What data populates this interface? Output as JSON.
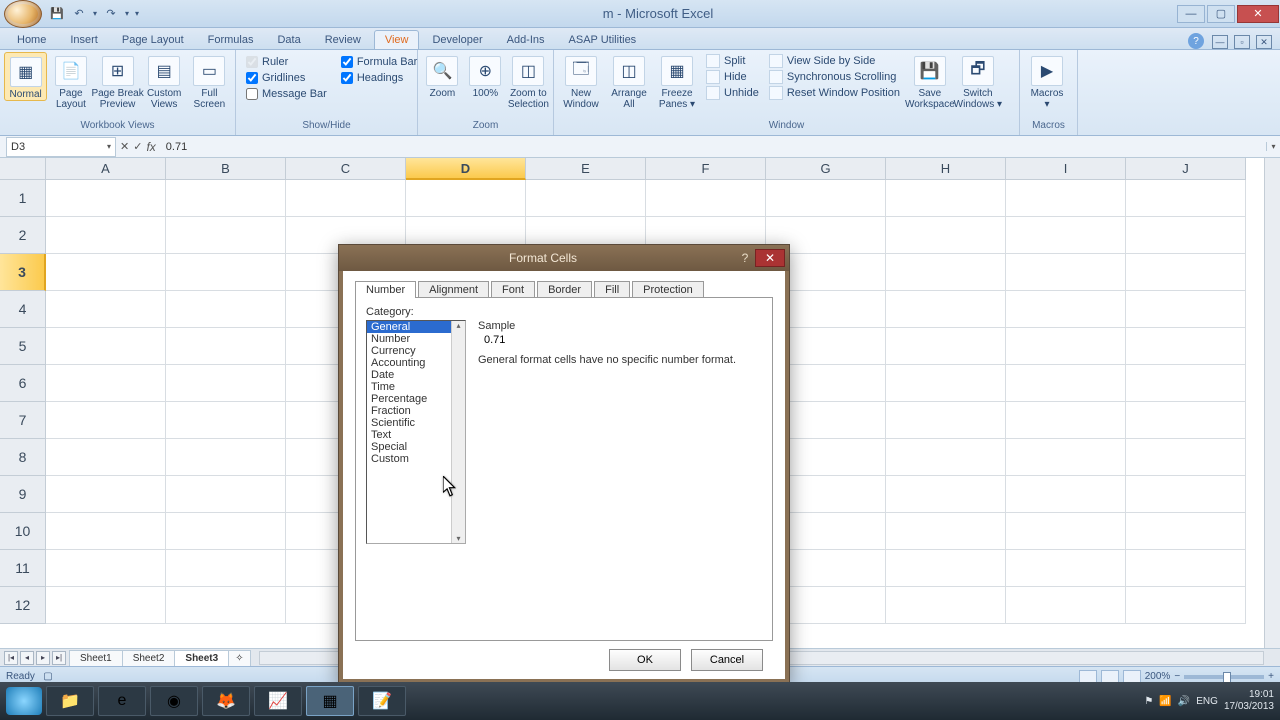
{
  "app": {
    "title": "m - Microsoft Excel"
  },
  "qat": {
    "save": "💾",
    "undo": "↶",
    "redo": "↷"
  },
  "tabs": [
    "Home",
    "Insert",
    "Page Layout",
    "Formulas",
    "Data",
    "Review",
    "View",
    "Developer",
    "Add-Ins",
    "ASAP Utilities"
  ],
  "active_tab": "View",
  "ribbon": {
    "workbook_views": {
      "label": "Workbook Views",
      "normal": "Normal",
      "page_layout": "Page\nLayout",
      "page_break": "Page Break\nPreview",
      "custom": "Custom\nViews",
      "full": "Full\nScreen"
    },
    "show_hide": {
      "label": "Show/Hide",
      "ruler": "Ruler",
      "gridlines": "Gridlines",
      "message_bar": "Message Bar",
      "formula_bar": "Formula Bar",
      "headings": "Headings"
    },
    "zoom_g": {
      "label": "Zoom",
      "zoom": "Zoom",
      "p100": "100%",
      "zoom_sel": "Zoom to\nSelection"
    },
    "window": {
      "label": "Window",
      "new": "New\nWindow",
      "arrange": "Arrange\nAll",
      "freeze": "Freeze\nPanes ▾",
      "split": "Split",
      "hide": "Hide",
      "unhide": "Unhide",
      "side": "View Side by Side",
      "sync": "Synchronous Scrolling",
      "reset": "Reset Window Position",
      "save_ws": "Save\nWorkspace",
      "switch": "Switch\nWindows ▾"
    },
    "macros": {
      "label": "Macros",
      "btn": "Macros\n▾"
    }
  },
  "namebox": "D3",
  "formula": "0.71",
  "columns": [
    "A",
    "B",
    "C",
    "D",
    "E",
    "F",
    "G",
    "H",
    "I",
    "J"
  ],
  "sel_col": "D",
  "rows": [
    "1",
    "2",
    "3",
    "4",
    "5",
    "6",
    "7",
    "8",
    "9",
    "10",
    "11",
    "12"
  ],
  "sel_row": "3",
  "sheets": {
    "s1": "Sheet1",
    "s2": "Sheet2",
    "s3": "Sheet3",
    "active": "Sheet3"
  },
  "status": {
    "ready": "Ready",
    "zoom": "200%"
  },
  "dialog": {
    "title": "Format Cells",
    "tabs": [
      "Number",
      "Alignment",
      "Font",
      "Border",
      "Fill",
      "Protection"
    ],
    "active_tab": "Number",
    "category_label": "Category:",
    "categories": [
      "General",
      "Number",
      "Currency",
      "Accounting",
      "Date",
      "Time",
      "Percentage",
      "Fraction",
      "Scientific",
      "Text",
      "Special",
      "Custom"
    ],
    "selected_category": "General",
    "sample_label": "Sample",
    "sample_value": "0.71",
    "description": "General format cells have no specific number format.",
    "ok": "OK",
    "cancel": "Cancel"
  },
  "tray": {
    "lang": "ENG",
    "time": "19:01",
    "date": "17/03/2013"
  }
}
